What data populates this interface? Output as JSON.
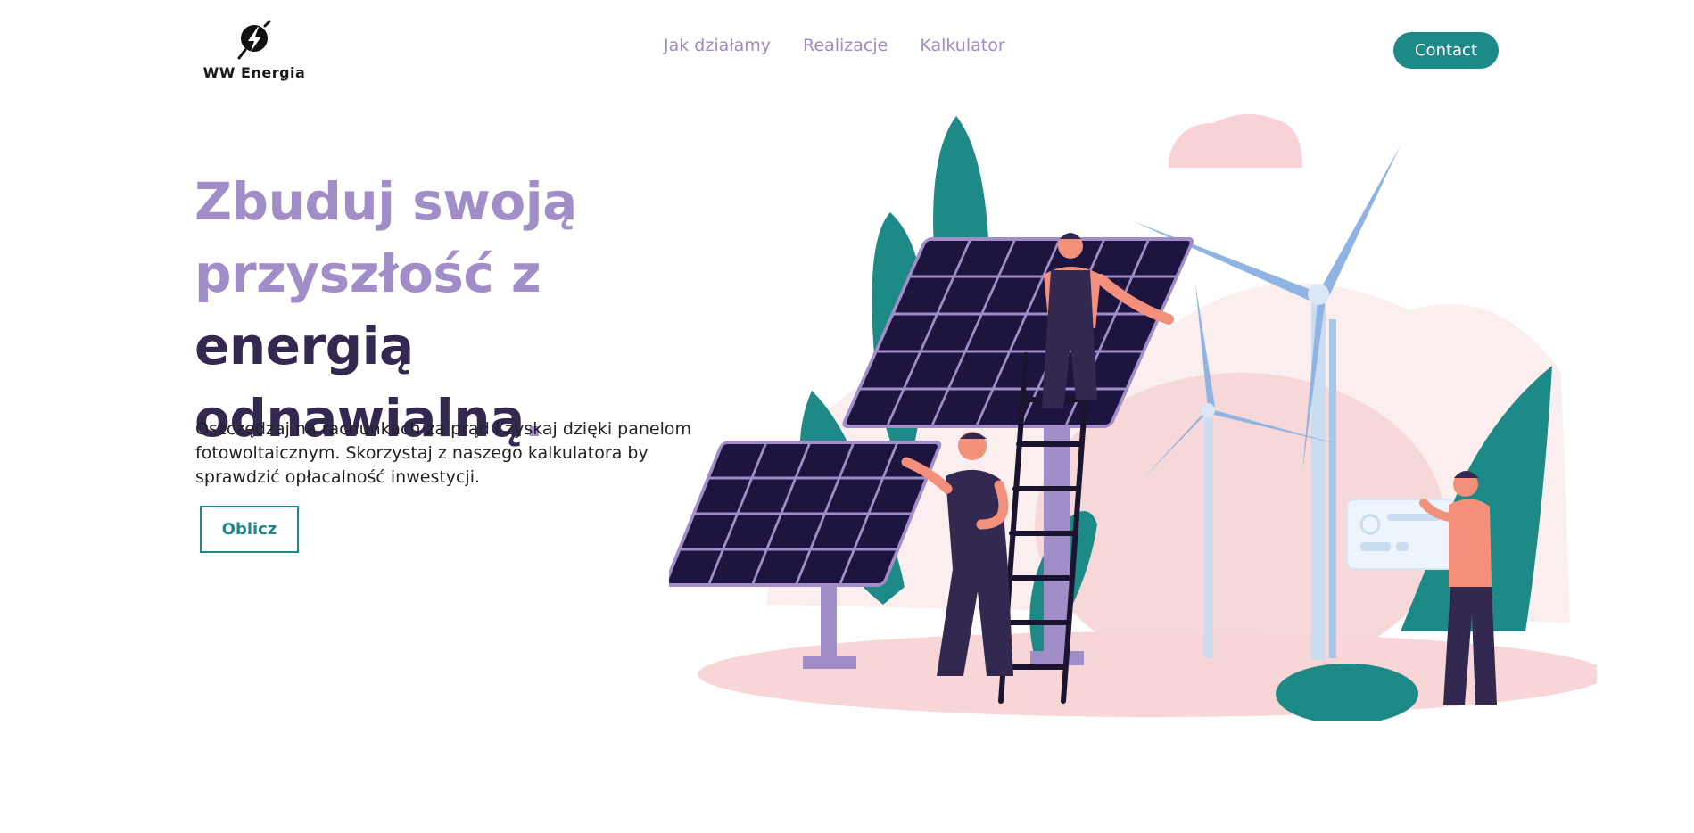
{
  "logo": {
    "text": "WW Energia",
    "icon": "lightning-bolt-icon"
  },
  "nav": {
    "items": [
      {
        "label": "Jak działamy"
      },
      {
        "label": "Realizacje"
      },
      {
        "label": "Kalkulator"
      }
    ],
    "contact_label": "Contact"
  },
  "hero": {
    "title_part1": "Zbuduj swoją przyszłość z ",
    "title_part2": "energią odnawialną",
    "title_dot": ".",
    "description": "Oszczędzaj na rachunkach za prąd i zyskaj dzięki panelom fotowoltaicznym. Skorzystaj z naszego kalkulatora by sprawdzić opłacalność inwestycji.",
    "cta_label": "Oblicz"
  },
  "illustration": {
    "subject": "solar panels, wind turbines and workers"
  },
  "colors": {
    "accent_teal": "#1e8a87",
    "purple_light": "#a18ec8",
    "purple_dark": "#33284f",
    "nav_link": "#9f8bc4"
  }
}
